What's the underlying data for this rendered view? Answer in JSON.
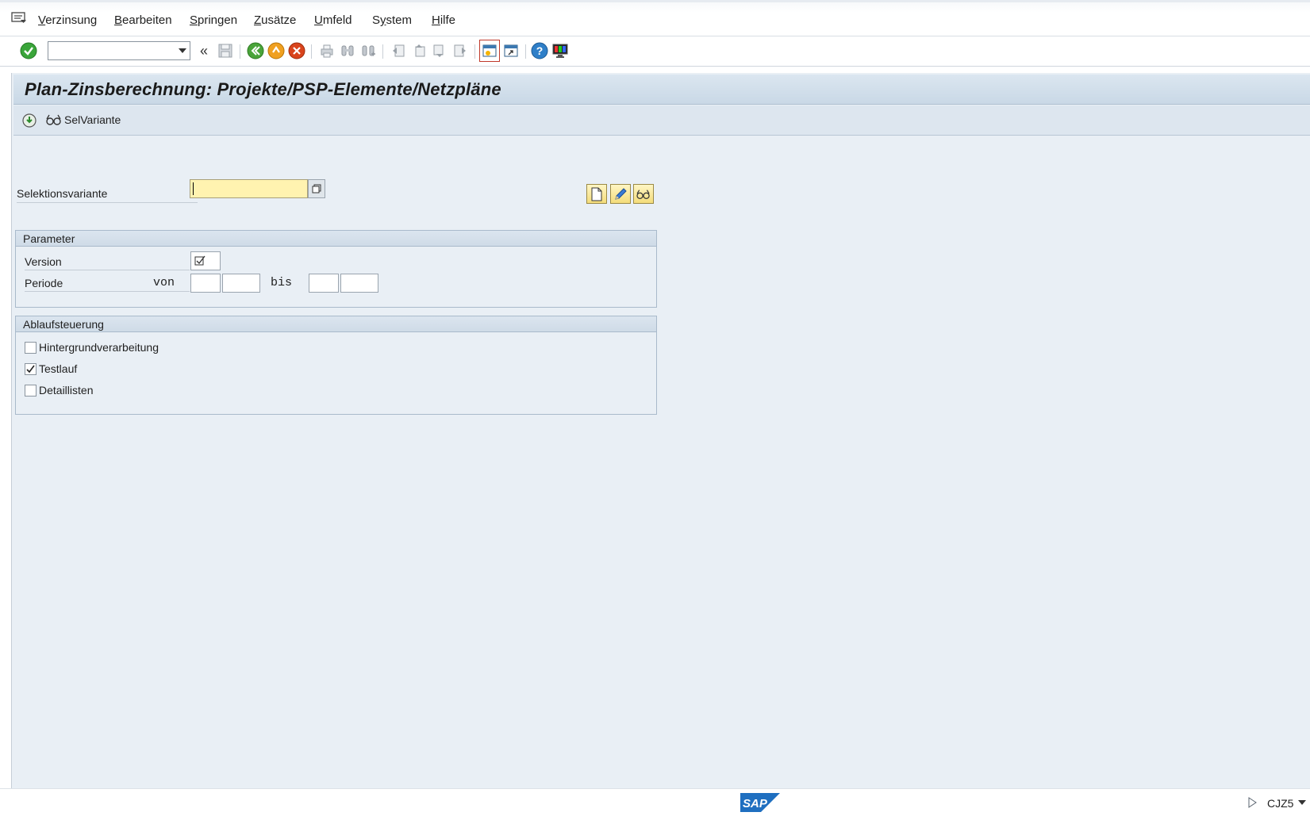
{
  "menu": {
    "items": [
      {
        "label": "Verzinsung",
        "acc": "V",
        "rest": "erzinsung"
      },
      {
        "label": "Bearbeiten",
        "acc": "B",
        "rest": "earbeiten"
      },
      {
        "label": "Springen",
        "acc": "S",
        "rest": "pringen"
      },
      {
        "label": "Zusätze",
        "acc": "Z",
        "rest": "usätze"
      },
      {
        "label": "Umfeld",
        "acc": "U",
        "rest": "mfeld"
      },
      {
        "label": "System",
        "acc": "y",
        "pre": "S",
        "rest": "stem"
      },
      {
        "label": "Hilfe",
        "acc": "H",
        "rest": "ilfe"
      }
    ]
  },
  "toolbar": {
    "command_value": "",
    "icons": [
      "enter-icon",
      "save-icon",
      "back-icon",
      "exit-icon",
      "cancel-icon",
      "print-icon",
      "find-icon",
      "find-next-icon",
      "first-page-icon",
      "previous-page-icon",
      "next-page-icon",
      "last-page-icon",
      "new-session-icon",
      "shortcut-icon",
      "help-icon",
      "customize-layout-icon"
    ]
  },
  "page": {
    "title": "Plan-Zinsberechnung: Projekte/PSP-Elemente/Netzpläne",
    "app_toolbar": {
      "selvariante_label": "SelVariante"
    },
    "selektionsvariante": {
      "label": "Selektionsvariante",
      "value": ""
    },
    "parameter": {
      "title": "Parameter",
      "version_label": "Version",
      "periode_label": "Periode",
      "von_label": "von",
      "bis_label": "bis"
    },
    "ablauf": {
      "title": "Ablaufsteuerung",
      "items": [
        {
          "label": "Hintergrundverarbeitung",
          "checked": false
        },
        {
          "label": "Testlauf",
          "checked": true
        },
        {
          "label": "Detaillisten",
          "checked": false
        }
      ]
    }
  },
  "status": {
    "logo_text": "SAP",
    "transaction": "CJZ5"
  },
  "colors": {
    "input_required": "#fff3b0",
    "workarea_bg": "#e9eff5",
    "title_bar": "#c9d8e6"
  }
}
